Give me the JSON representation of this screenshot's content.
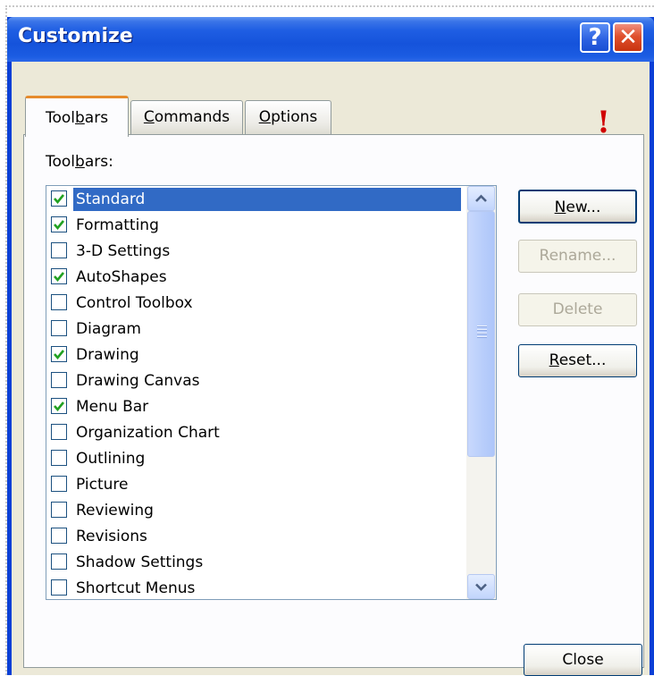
{
  "window": {
    "title": "Customize"
  },
  "titlebar_buttons": {
    "help": "?",
    "close": "✕"
  },
  "tabs": [
    {
      "pre": "Tool",
      "key": "b",
      "post": "ars",
      "active": true
    },
    {
      "pre": "",
      "key": "C",
      "post": "ommands",
      "active": false
    },
    {
      "pre": "",
      "key": "O",
      "post": "ptions",
      "active": false
    }
  ],
  "list_label": {
    "pre": "Tool",
    "key": "b",
    "post": "ars:"
  },
  "toolbars": [
    {
      "label": "Standard",
      "checked": true,
      "selected": true
    },
    {
      "label": "Formatting",
      "checked": true,
      "selected": false
    },
    {
      "label": "3-D Settings",
      "checked": false,
      "selected": false
    },
    {
      "label": "AutoShapes",
      "checked": true,
      "selected": false
    },
    {
      "label": "Control Toolbox",
      "checked": false,
      "selected": false
    },
    {
      "label": "Diagram",
      "checked": false,
      "selected": false
    },
    {
      "label": "Drawing",
      "checked": true,
      "selected": false
    },
    {
      "label": "Drawing Canvas",
      "checked": false,
      "selected": false
    },
    {
      "label": "Menu Bar",
      "checked": true,
      "selected": false
    },
    {
      "label": "Organization Chart",
      "checked": false,
      "selected": false
    },
    {
      "label": "Outlining",
      "checked": false,
      "selected": false
    },
    {
      "label": "Picture",
      "checked": false,
      "selected": false
    },
    {
      "label": "Reviewing",
      "checked": false,
      "selected": false
    },
    {
      "label": "Revisions",
      "checked": false,
      "selected": false
    },
    {
      "label": "Shadow Settings",
      "checked": false,
      "selected": false
    },
    {
      "label": "Shortcut Menus",
      "checked": false,
      "selected": false
    }
  ],
  "buttons": {
    "new": {
      "key": "N",
      "post": "ew..."
    },
    "rename": {
      "label": "Rename..."
    },
    "delete": {
      "label": "Delete"
    },
    "reset": {
      "key": "R",
      "post": "eset..."
    },
    "close": {
      "label": "Close"
    }
  },
  "annotation": "!",
  "colors": {
    "title_bar": "#1553db",
    "selection": "#316ac5",
    "check": "#21a121",
    "focus_tab": "#e68b2c",
    "annotation": "#d00000"
  }
}
